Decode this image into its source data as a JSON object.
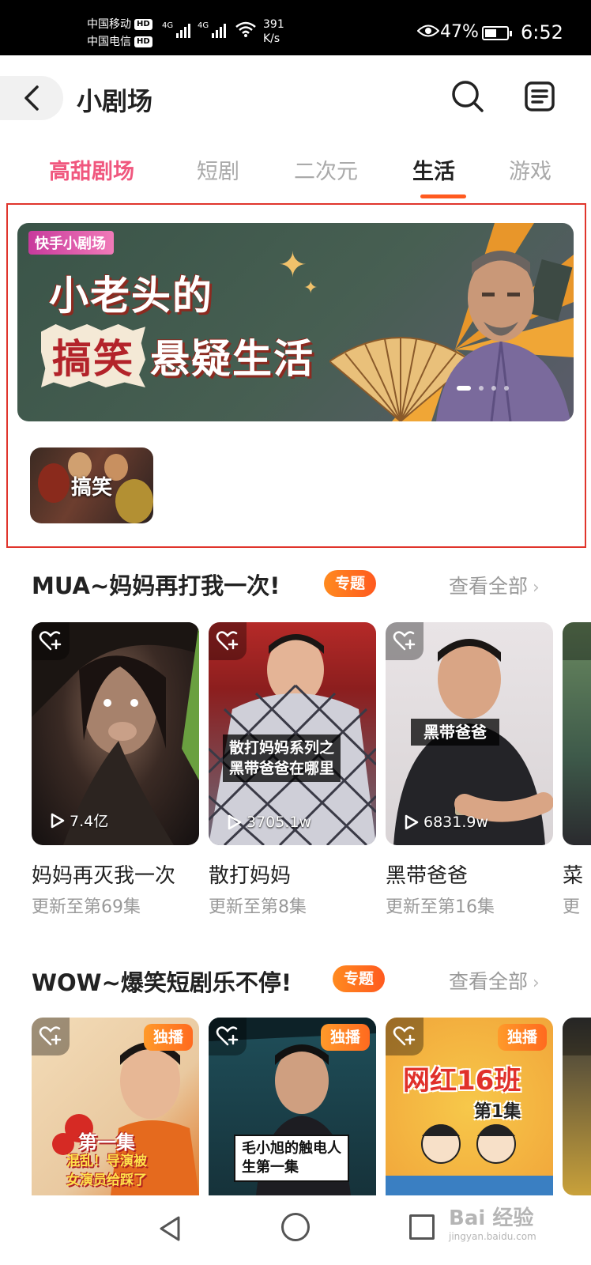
{
  "status_bar": {
    "carrier1": "中国移动",
    "carrier2": "中国电信",
    "hd": "HD",
    "net_type": "4G",
    "net_speed_value": "391",
    "net_speed_unit": "K/s",
    "battery_pct": "47%",
    "time": "6:52"
  },
  "header": {
    "title": "小剧场"
  },
  "tabs": [
    "高甜剧场",
    "短剧",
    "二次元",
    "生活",
    "游戏"
  ],
  "active_tab": "生活",
  "banner": {
    "brand": "快手小剧场",
    "title_line1": "小老头的",
    "title_burst": "搞笑",
    "title_line2": "悬疑生活"
  },
  "category_tag": {
    "label": "搞笑"
  },
  "section1": {
    "title": "MUA~妈妈再打我一次!",
    "badge": "专题",
    "see_all": "查看全部",
    "cards": [
      {
        "title": "妈妈再灭我一次",
        "subtitle": "更新至第69集",
        "plays": "7.4亿"
      },
      {
        "title": "散打妈妈",
        "subtitle": "更新至第8集",
        "plays": "3705.1w",
        "caption_line1": "散打妈妈系列之",
        "caption_line2": "黑带爸爸在哪里"
      },
      {
        "title": "黑带爸爸",
        "subtitle": "更新至第16集",
        "plays": "6831.9w",
        "caption": "黑带爸爸"
      },
      {
        "title": "菜",
        "subtitle": "更"
      }
    ]
  },
  "section2": {
    "title": "WOW~爆笑短剧乐不停!",
    "badge": "专题",
    "see_all": "查看全部",
    "cards": [
      {
        "badge": "独播",
        "caption_line1": "第一集",
        "caption_line2": "混乱！导演被",
        "caption_line3": "女演员给踩了"
      },
      {
        "badge": "独播",
        "caption_line1": "毛小旭的触电人",
        "caption_line2": "生第一集"
      },
      {
        "badge": "独播",
        "caption_line1": "网红16班",
        "caption_line2": "第1集"
      }
    ]
  },
  "watermark": {
    "text": "Bai 经验",
    "sub": "jingyan.baidu.com"
  }
}
